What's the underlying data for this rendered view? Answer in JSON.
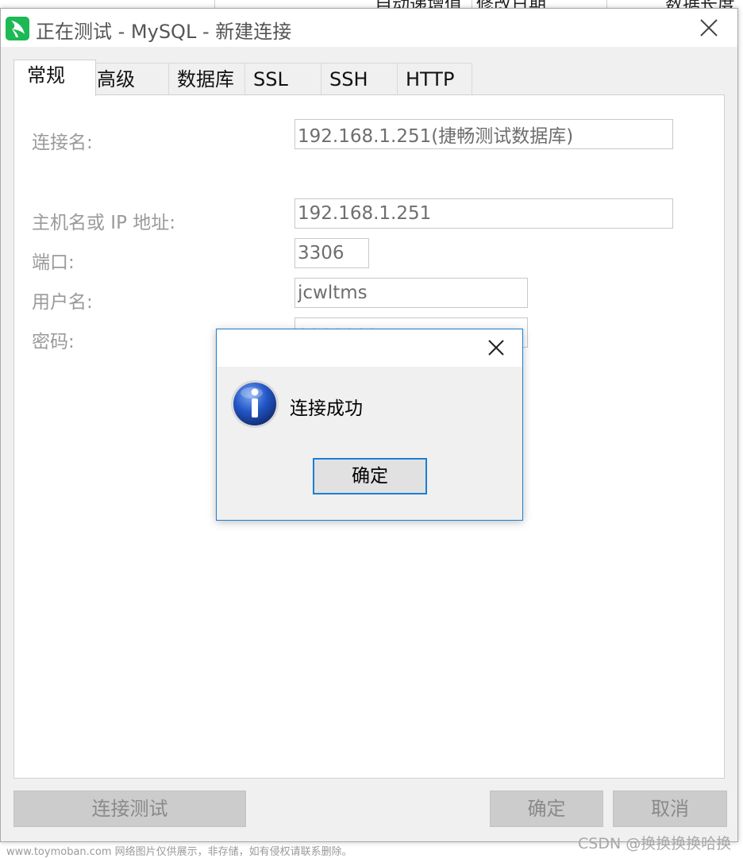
{
  "background_window": {
    "header_cells": [
      "自动递增值",
      "修改日期",
      "数据长度"
    ]
  },
  "dialog": {
    "title": "正在测试 - MySQL - 新建连接",
    "tabs": [
      "常规",
      "高级",
      "数据库",
      "SSL",
      "SSH",
      "HTTP"
    ],
    "active_tab": "常规",
    "fields": {
      "connection_name": {
        "label": "连接名:",
        "value": "192.168.1.251(捷畅测试数据库)"
      },
      "host": {
        "label": "主机名或 IP 地址:",
        "value": "192.168.1.251"
      },
      "port": {
        "label": "端口:",
        "value": "3306"
      },
      "username": {
        "label": "用户名:",
        "value": "jcwltms"
      },
      "password": {
        "label": "密码:",
        "value": "•••••••"
      }
    },
    "buttons": {
      "test_connection": "连接测试",
      "ok": "确定",
      "cancel": "取消"
    }
  },
  "message_box": {
    "icon": "info-icon",
    "message": "连接成功",
    "ok_label": "确定"
  },
  "watermarks": {
    "left": "www.toymoban.com 网络图片仅供展示，非存储，如有侵权请联系删除。",
    "right": "CSDN @换换换换哈换"
  },
  "colors": {
    "accent_border": "#1a7fd4",
    "app_icon": "#1db954",
    "disabled_button": "#cccccc"
  }
}
